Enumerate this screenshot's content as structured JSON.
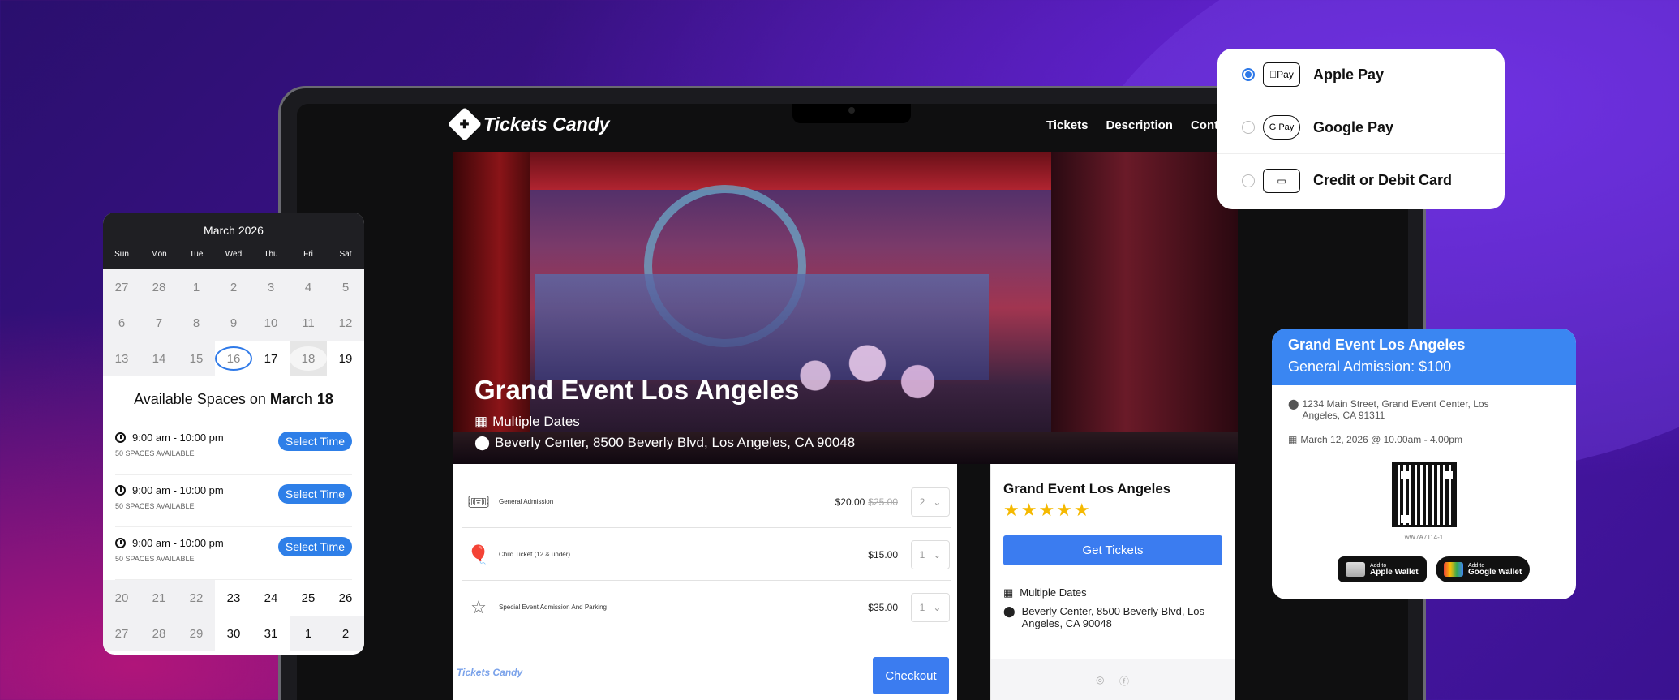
{
  "site": {
    "brand": "Tickets Candy",
    "nav": [
      "Tickets",
      "Description",
      "Conta"
    ]
  },
  "hero": {
    "title": "Grand Event Los Angeles",
    "dates": "Multiple Dates",
    "location": "Beverly Center, 8500 Beverly Blvd, Los Angeles, CA 90048"
  },
  "tickets": [
    {
      "name": "General Admission",
      "price": "$20.00",
      "old_price": "$25.00",
      "qty": "2"
    },
    {
      "name": "Child Ticket (12 & under)",
      "price": "$15.00",
      "old_price": "",
      "qty": "1"
    },
    {
      "name": "Special Event Admission And Parking",
      "price": "$35.00",
      "old_price": "",
      "qty": "1"
    }
  ],
  "footer": {
    "brand": "Tickets Candy",
    "checkout": "Checkout"
  },
  "sidebar": {
    "title": "Grand Event Los Angeles",
    "rating": 5,
    "get_tickets": "Get Tickets",
    "dates": "Multiple Dates",
    "location": "Beverly Center, 8500 Beverly Blvd, Los Angeles, CA 90048"
  },
  "calendar": {
    "month": "March 2026",
    "days": [
      "Sun",
      "Mon",
      "Tue",
      "Wed",
      "Thu",
      "Fri",
      "Sat"
    ],
    "weeks": [
      [
        "27",
        "28",
        "1",
        "2",
        "3",
        "4",
        "5"
      ],
      [
        "6",
        "7",
        "8",
        "9",
        "10",
        "11",
        "12"
      ],
      [
        "13",
        "14",
        "15",
        "16",
        "17",
        "18",
        "19"
      ]
    ],
    "weeks_after": [
      [
        "20",
        "21",
        "22",
        "23",
        "24",
        "25",
        "26"
      ],
      [
        "27",
        "28",
        "29",
        "30",
        "31",
        "1",
        "2"
      ]
    ],
    "available_prefix": "Available Spaces on",
    "available_date": "March 18",
    "slots": [
      {
        "time": "9:00 am - 10:00 pm",
        "spaces": "50 SPACES AVAILABLE",
        "button": "Select Time"
      },
      {
        "time": "9:00 am - 10:00 pm",
        "spaces": "50 SPACES AVAILABLE",
        "button": "Select Time"
      },
      {
        "time": "9:00 am - 10:00 pm",
        "spaces": "50 SPACES AVAILABLE",
        "button": "Select Time"
      }
    ]
  },
  "payment": {
    "options": [
      {
        "label": "Apple Pay",
        "badge": "Pay",
        "selected": true
      },
      {
        "label": "Google Pay",
        "badge": "G Pay",
        "selected": false
      },
      {
        "label": "Credit or Debit Card",
        "badge": "",
        "selected": false
      }
    ]
  },
  "pass": {
    "title": "Grand Event Los Angeles",
    "subtitle": "General Admission: $100",
    "address": "1234 Main Street, Grand Event Center, Los Angeles, CA 91311",
    "datetime": "March 12, 2026 @ 10.00am - 4.00pm",
    "code": "wW7A7114-1",
    "apple_small": "Add to",
    "apple_big": "Apple Wallet",
    "google_small": "Add to",
    "google_big": "Google Wallet"
  },
  "colors": {
    "accent": "#3b7cf0",
    "star": "#f5b900",
    "pass_header": "#3a86f2"
  }
}
